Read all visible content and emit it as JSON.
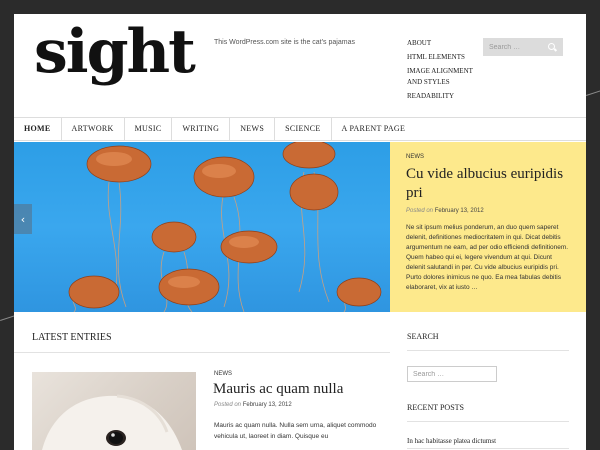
{
  "site": {
    "title": "sight",
    "tagline": "This WordPress.com site is the cat’s pajamas"
  },
  "top_menu": [
    {
      "label": "About"
    },
    {
      "label": "HTML Elements"
    },
    {
      "label": "Image Alignment and Styles"
    },
    {
      "label": "Readability"
    }
  ],
  "header_search": {
    "placeholder": "Search …"
  },
  "nav": {
    "items": [
      {
        "label": "Home",
        "active": true
      },
      {
        "label": "Artwork",
        "active": false
      },
      {
        "label": "Music",
        "active": false
      },
      {
        "label": "Writing",
        "active": false
      },
      {
        "label": "News",
        "active": false
      },
      {
        "label": "Science",
        "active": false
      },
      {
        "label": "A Parent Page",
        "active": false
      }
    ]
  },
  "slider": {
    "category": "News",
    "title": "Cu vide albucius euripidis pri",
    "posted_label": "Posted on",
    "date": "February 13, 2012",
    "text": "Ne sit ipsum melius ponderum, an duo quem saperet delenit, definitiones mediocritatem in qui. Dicat debitis argumentum ne eam, ad per odio efficiendi definitionem. Quem habeo qui ei, legere vivendum at qui. Dicunt delenit salutandi in per. Cu vide albucius euripidis pri. Purto dolores inimicus ne quo. Ea mea fabulas debitis elaboraret, vix at iusto …",
    "prev_icon": "chevron-left-icon",
    "next_icon": "chevron-right-icon",
    "caption_bg": "#fde98c"
  },
  "latest": {
    "heading": "Latest Entries",
    "entry": {
      "category": "News",
      "title": "Mauris ac quam nulla",
      "posted_label": "Posted on",
      "date": "February 13, 2012",
      "excerpt": "Mauris ac quam nulla. Nulla sem urna, aliquet commodo vehicula ut, laoreet in diam. Quisque eu"
    }
  },
  "sidebar": {
    "search_heading": "Search",
    "search_placeholder": "Search …",
    "recent_heading": "Recent Posts",
    "recent_items": [
      {
        "label": "In hac habitasse platea dictumst"
      }
    ]
  }
}
